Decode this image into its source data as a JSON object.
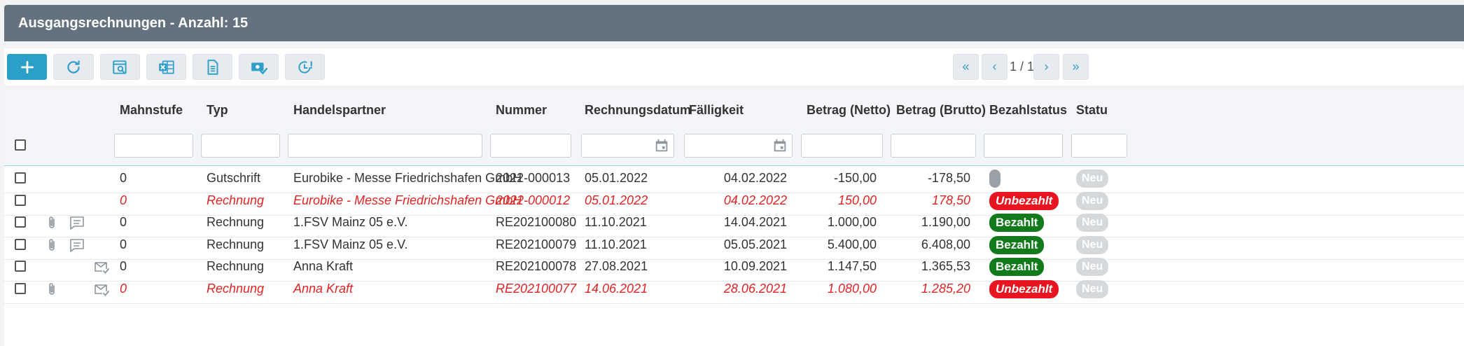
{
  "title": "Ausgangsrechnungen - Anzahl: 15",
  "toolbar": {
    "buttons": [
      {
        "icon": "plus-icon"
      },
      {
        "icon": "refresh-icon"
      },
      {
        "icon": "search-document-icon"
      },
      {
        "icon": "excel-export-icon"
      },
      {
        "icon": "pdf-document-icon"
      },
      {
        "icon": "payment-check-icon"
      },
      {
        "icon": "clock-alert-icon"
      }
    ],
    "pagination": {
      "first": "«",
      "prev": "‹",
      "page_info": "1 / 1",
      "next": "›",
      "last": "»"
    }
  },
  "columns": {
    "mahnstufe": "Mahnstufe",
    "typ": "Typ",
    "handelspartner": "Handelspartner",
    "nummer": "Nummer",
    "rechnungsdatum": "Rechnungsdatum",
    "faelligkeit": "Fälligkeit",
    "netto": "Betrag (Netto)",
    "brutto": "Betrag (Brutto)",
    "bezahlstatus": "Bezahlstatus",
    "status": "Statu"
  },
  "rows": [
    {
      "attachment": false,
      "comment": false,
      "mail": false,
      "mahnstufe": "0",
      "typ": "Gutschrift",
      "partner": "Eurobike - Messe Friedrichshafen GmbH",
      "nummer": "2022-000013",
      "datum": "05.01.2022",
      "faellig": "04.02.2022",
      "netto": "-150,00",
      "brutto": "-178,50",
      "bezahlstatus": "",
      "status": "Neu",
      "overdue": false,
      "badge": "grey"
    },
    {
      "attachment": false,
      "comment": false,
      "mail": false,
      "mahnstufe": "0",
      "typ": "Rechnung",
      "partner": "Eurobike - Messe Friedrichshafen GmbH",
      "nummer": "2022-000012",
      "datum": "05.01.2022",
      "faellig": "04.02.2022",
      "netto": "150,00",
      "brutto": "178,50",
      "bezahlstatus": "Unbezahlt",
      "status": "Neu",
      "overdue": true,
      "badge": "red"
    },
    {
      "attachment": true,
      "comment": true,
      "mail": false,
      "mahnstufe": "0",
      "typ": "Rechnung",
      "partner": "1.FSV Mainz 05 e.V.",
      "nummer": "RE202100080",
      "datum": "11.10.2021",
      "faellig": "14.04.2021",
      "netto": "1.000,00",
      "brutto": "1.190,00",
      "bezahlstatus": "Bezahlt",
      "status": "Neu",
      "overdue": false,
      "badge": "green"
    },
    {
      "attachment": true,
      "comment": true,
      "mail": false,
      "mahnstufe": "0",
      "typ": "Rechnung",
      "partner": "1.FSV Mainz 05 e.V.",
      "nummer": "RE202100079",
      "datum": "11.10.2021",
      "faellig": "05.05.2021",
      "netto": "5.400,00",
      "brutto": "6.408,00",
      "bezahlstatus": "Bezahlt",
      "status": "Neu",
      "overdue": false,
      "badge": "green"
    },
    {
      "attachment": false,
      "comment": false,
      "mail": true,
      "mahnstufe": "0",
      "typ": "Rechnung",
      "partner": "Anna Kraft",
      "nummer": "RE202100078",
      "datum": "27.08.2021",
      "faellig": "10.09.2021",
      "netto": "1.147,50",
      "brutto": "1.365,53",
      "bezahlstatus": "Bezahlt",
      "status": "Neu",
      "overdue": false,
      "badge": "green"
    },
    {
      "attachment": true,
      "comment": false,
      "mail": true,
      "mahnstufe": "0",
      "typ": "Rechnung",
      "partner": "Anna Kraft",
      "nummer": "RE202100077",
      "datum": "14.06.2021",
      "faellig": "28.06.2021",
      "netto": "1.080,00",
      "brutto": "1.285,20",
      "bezahlstatus": "Unbezahlt",
      "status": "Neu",
      "overdue": true,
      "badge": "red"
    }
  ]
}
